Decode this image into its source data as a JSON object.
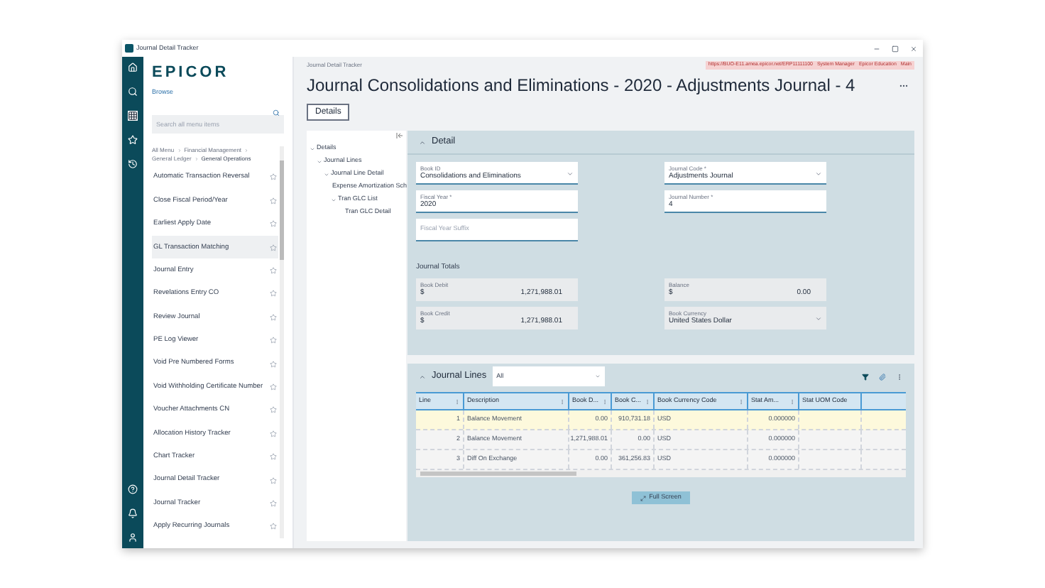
{
  "window": {
    "title": "Journal Detail Tracker"
  },
  "menu": {
    "logo": "EPICOR",
    "browse": "Browse",
    "search": {
      "placeholder": "Search all menu items"
    },
    "breadcrumb": [
      "All Menu",
      "Financial Management",
      "General Ledger",
      "General Operations"
    ],
    "items": [
      {
        "label": "Automatic Transaction Reversal",
        "selected": false
      },
      {
        "label": "Close Fiscal Period/Year",
        "selected": false
      },
      {
        "label": "Earliest Apply Date",
        "selected": false
      },
      {
        "label": "GL Transaction Matching",
        "selected": true
      },
      {
        "label": "Journal Entry",
        "selected": false
      },
      {
        "label": "Revelations Entry CO",
        "selected": false
      },
      {
        "label": "Review Journal",
        "selected": false
      },
      {
        "label": "PE Log Viewer",
        "selected": false
      },
      {
        "label": "Void Pre Numbered Forms",
        "selected": false
      },
      {
        "label": "Void Withholding Certificate Number",
        "selected": false
      },
      {
        "label": "Voucher Attachments CN",
        "selected": false
      },
      {
        "label": "Allocation History Tracker",
        "selected": false
      },
      {
        "label": "Chart Tracker",
        "selected": false
      },
      {
        "label": "Journal Detail Tracker",
        "selected": false
      },
      {
        "label": "Journal Tracker",
        "selected": false
      },
      {
        "label": "Apply Recurring Journals",
        "selected": false
      }
    ]
  },
  "header": {
    "breadcrumb": "Journal Detail Tracker",
    "url": "https://BUO-E11.amea.epicor.net/ERP11111100",
    "user": "System Manager",
    "company": "Epicor Education",
    "site": "Main",
    "title": "Journal Consolidations and Eliminations - 2020 - Adjustments Journal - 4",
    "tab": "Details"
  },
  "tree": [
    {
      "label": "Details",
      "children": [
        {
          "label": "Journal Lines",
          "children": [
            {
              "label": "Journal Line Detail",
              "children": [
                {
                  "label": "Expense Amortization Sch"
                },
                {
                  "label": "Tran GLC List",
                  "children": [
                    {
                      "label": "Tran GLC Detail"
                    }
                  ]
                }
              ]
            }
          ]
        }
      ]
    }
  ],
  "detail": {
    "title": "Detail",
    "fields": [
      {
        "label": "Book ID",
        "value": "Consolidations and Eliminations",
        "kind": "dropdown"
      },
      {
        "label": "Journal Code *",
        "value": "Adjustments Journal",
        "kind": "dropdown"
      },
      {
        "label": "Fiscal Year *",
        "value": "2020",
        "kind": "text"
      },
      {
        "label": "Journal Number *",
        "value": "4",
        "kind": "text"
      },
      {
        "placeholder": "Fiscal Year Suffix",
        "kind": "text"
      }
    ],
    "totals_title": "Journal Totals",
    "totals": [
      {
        "label": "Book Debit",
        "prefix": "$",
        "value": "1,271,988.01",
        "kind": "amount"
      },
      {
        "label": "Balance",
        "prefix": "$",
        "value": "0.00",
        "kind": "amount"
      },
      {
        "label": "Book Credit",
        "prefix": "$",
        "value": "1,271,988.01",
        "kind": "amount"
      },
      {
        "label": "Book Currency",
        "value": "United States Dollar",
        "kind": "dropdown"
      }
    ]
  },
  "journal_lines": {
    "title": "Journal Lines",
    "filter": "All",
    "columns": [
      "Line",
      "Description",
      "Book D...",
      "Book C...",
      "Book Currency Code",
      "Stat Am...",
      "Stat UOM Code"
    ],
    "rows": [
      {
        "cells": [
          "1",
          "Balance Movement",
          "0.00",
          "910,731.18",
          "USD",
          "0.000000",
          ""
        ],
        "selected": true
      },
      {
        "cells": [
          "2",
          "Balance Movement",
          "1,271,988.01",
          "0.00",
          "USD",
          "0.000000",
          ""
        ],
        "selected": false
      },
      {
        "cells": [
          "3",
          "Diff On Exchange",
          "0.00",
          "361,256.83",
          "USD",
          "0.000000",
          ""
        ],
        "selected": false
      }
    ],
    "full_screen": "Full Screen"
  }
}
